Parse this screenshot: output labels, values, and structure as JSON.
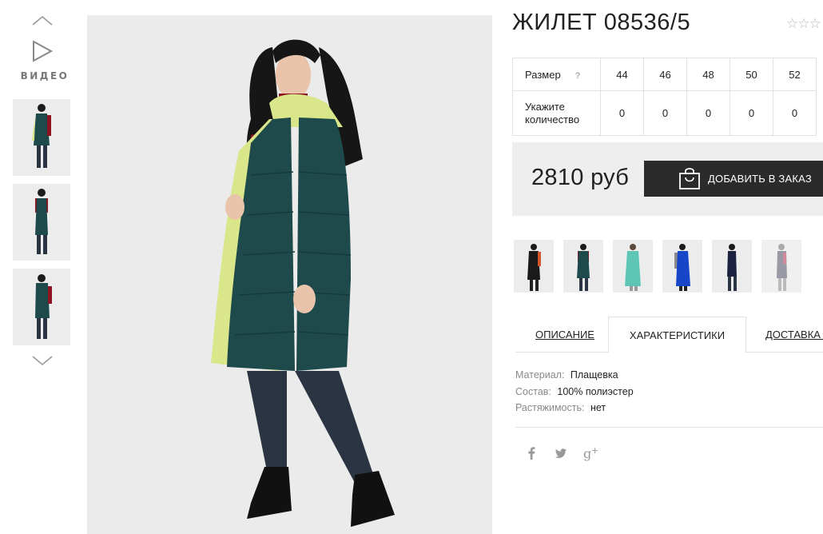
{
  "gallery": {
    "video_label": "ВИДЕО"
  },
  "product": {
    "title": "ЖИЛЕТ 08536/5",
    "rating_stars": "☆☆☆"
  },
  "size_table": {
    "size_label": "Размер",
    "help_icon_text": "?",
    "sizes": [
      "44",
      "46",
      "48",
      "50",
      "52"
    ],
    "quantity_label": "Укажите количество",
    "quantities": [
      "0",
      "0",
      "0",
      "0",
      "0"
    ]
  },
  "purchase": {
    "price": "2810 руб",
    "add_button": "ДОБАВИТЬ В ЗАКАЗ"
  },
  "tabs": [
    {
      "label": "ОПИСАНИЕ",
      "active": false
    },
    {
      "label": "ХАРАКТЕРИСТИКИ",
      "active": true
    },
    {
      "label": "ДОСТАВКА И",
      "active": false
    }
  ],
  "characteristics": [
    {
      "key": "Материал:",
      "value": "Плащевка"
    },
    {
      "key": "Состав:",
      "value": "100% полиэстер"
    },
    {
      "key": "Растяжимость:",
      "value": "нет"
    }
  ],
  "social": [
    {
      "name": "facebook",
      "glyph": "f"
    },
    {
      "name": "twitter",
      "glyph": "t"
    },
    {
      "name": "google-plus",
      "glyph": "g+"
    }
  ],
  "colors": {
    "vest_green": "#1f4a4c",
    "lining_lime": "#d9e68a",
    "sweater_red": "#8e1320",
    "jeans_dark": "#2a3442",
    "button_dark": "#2b2b2b",
    "price_bg": "#eeeeee"
  }
}
